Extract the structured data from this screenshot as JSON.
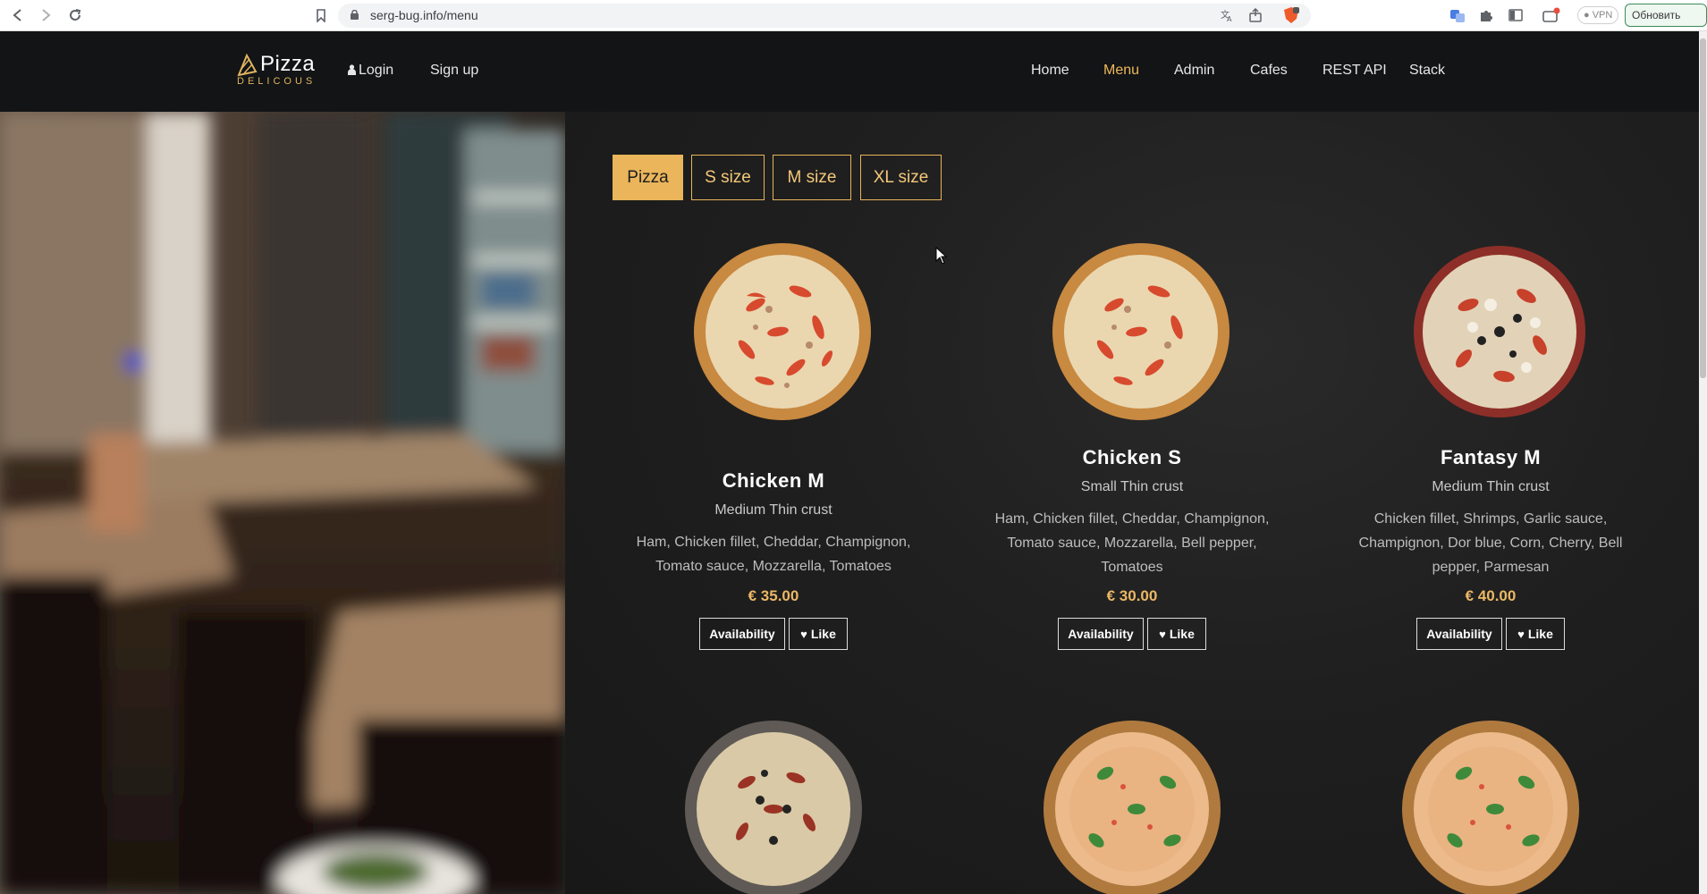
{
  "browser": {
    "url": "serg-bug.info/menu",
    "vpn_label": "VPN",
    "update_label": "Обновить"
  },
  "header": {
    "logo_title": "Pizza",
    "logo_subtitle": "DELICOUS",
    "login_label": "Login",
    "signup_label": "Sign up",
    "nav": [
      {
        "label": "Home",
        "active": false
      },
      {
        "label": "Menu",
        "active": true
      },
      {
        "label": "Admin",
        "active": false
      },
      {
        "label": "Cafes",
        "active": false
      },
      {
        "label": "REST API",
        "active": false
      },
      {
        "label": "Stack",
        "active": false
      }
    ]
  },
  "filters": [
    {
      "label": "Pizza",
      "active": true
    },
    {
      "label": "S size",
      "active": false
    },
    {
      "label": "M size",
      "active": false
    },
    {
      "label": "XL size",
      "active": false
    }
  ],
  "products": [
    {
      "name": "Chicken M",
      "size": "Medium Thin crust",
      "ingredients": "Ham, Chicken fillet, Cheddar, Champignon, Tomato sauce, Mozzarella, Tomatoes",
      "price": "€ 35.00",
      "availability_label": "Availability",
      "like_label": "Like"
    },
    {
      "name": "Chicken S",
      "size": "Small Thin crust",
      "ingredients": "Ham, Chicken fillet, Cheddar, Champignon, Tomato sauce, Mozzarella, Bell pepper, Tomatoes",
      "price": "€ 30.00",
      "availability_label": "Availability",
      "like_label": "Like"
    },
    {
      "name": "Fantasy M",
      "size": "Medium Thin crust",
      "ingredients": "Chicken fillet, Shrimps, Garlic sauce, Champignon, Dor blue, Corn, Cherry, Bell pepper, Parmesan",
      "price": "€ 40.00",
      "availability_label": "Availability",
      "like_label": "Like"
    }
  ],
  "colors": {
    "accent": "#eab55b",
    "header_bg": "#121416",
    "panel_bg": "#1f1f1f"
  }
}
